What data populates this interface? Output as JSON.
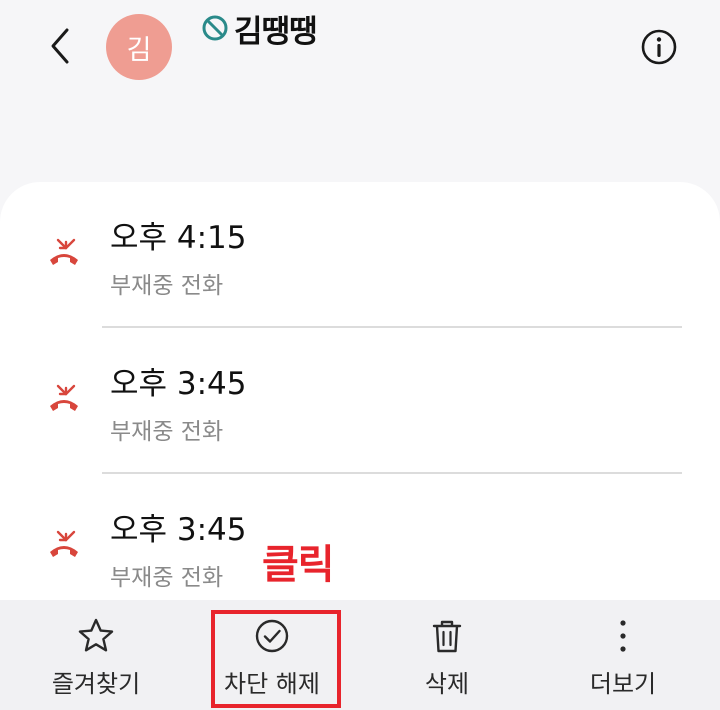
{
  "header": {
    "avatar_initial": "김",
    "contact_name": "김땡땡",
    "blocked_icon": "blocked-icon",
    "back_icon": "chevron-left-icon",
    "info_icon": "info-icon"
  },
  "calls": [
    {
      "time": "오후 4:15",
      "type": "부재중 전화",
      "icon": "missed-call-icon"
    },
    {
      "time": "오후 3:45",
      "type": "부재중 전화",
      "icon": "missed-call-icon"
    },
    {
      "time": "오후 3:45",
      "type": "부재중 전화",
      "icon": "missed-call-icon"
    }
  ],
  "annotation": {
    "text": "클릭",
    "color": "#e8242c"
  },
  "toolbar": {
    "favorite_label": "즐겨찾기",
    "unblock_label": "차단 해제",
    "delete_label": "삭제",
    "more_label": "더보기"
  },
  "colors": {
    "avatar": "#ef9d92",
    "missed_call": "#d8463c",
    "blocked": "#2a8a8a",
    "highlight": "#e8242c"
  }
}
